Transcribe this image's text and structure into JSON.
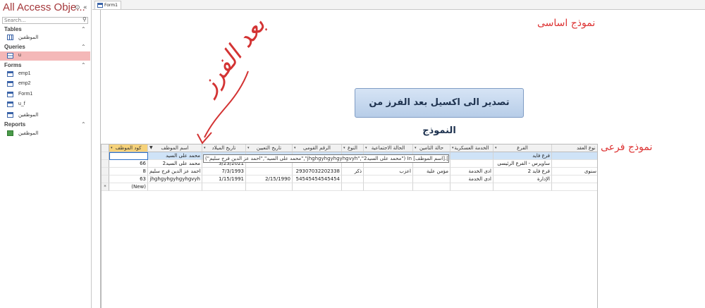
{
  "nav": {
    "title": "All Access Obje...",
    "search_placeholder": "Search...",
    "groups": [
      {
        "label": "Tables",
        "items": [
          {
            "label": "الموظفين",
            "icon": "table-icon"
          }
        ]
      },
      {
        "label": "Queries",
        "items": [
          {
            "label": "u",
            "icon": "query-icon",
            "selected": true
          }
        ]
      },
      {
        "label": "Forms",
        "items": [
          {
            "label": "emp1",
            "icon": "form-icon"
          },
          {
            "label": "emp2",
            "icon": "form-icon"
          },
          {
            "label": "Form1",
            "icon": "form-icon"
          },
          {
            "label": "u_f",
            "icon": "form-icon"
          },
          {
            "label": "الموظفين",
            "icon": "form-icon"
          }
        ]
      },
      {
        "label": "Reports",
        "items": [
          {
            "label": "الموظفين",
            "icon": "report-icon"
          }
        ]
      }
    ]
  },
  "tab": {
    "label": "Form1"
  },
  "form": {
    "main_label": "نموذج اساسى",
    "sub_label": "نموذج فرعى",
    "export_button": "تصدير الى اكسيل بعد الفرز من النموذج",
    "handwriting": "بعد الفرز"
  },
  "grid": {
    "columns": [
      "كود الموظف",
      "اسم الموظف",
      "تاريخ الميلاد",
      "تاريخ التعيين",
      "الرقم القومى",
      "النوع",
      "الحالة الاجتماعية",
      "حالة التامين",
      "الخدمة العسكرية",
      "الفرع",
      "نوع العقد"
    ],
    "rows": [
      [
        "",
        "محمد على السيد",
        "",
        "",
        "",
        "",
        "",
        "",
        "",
        "فرع فايد",
        ""
      ],
      [
        "66",
        "محمد على السيد2",
        "3/23/2021",
        "",
        "",
        "",
        "",
        "",
        "",
        "ساويرس - الفرع الرئيسى",
        ""
      ],
      [
        "8",
        "احمد عز الدين فرج سليم",
        "7/3/1993",
        "",
        "29307032202338",
        "ذكر",
        "اعزب",
        "مؤمن علية",
        "ادى الخدمة",
        "فرع فايد 2",
        "سنوى"
      ],
      [
        "63",
        "jhghgyhgyhgyhgvyh",
        "1/15/1991",
        "2/15/1990",
        "54545454545454",
        "",
        "",
        "",
        "ادى الخدمة",
        "الإدارة",
        ""
      ]
    ],
    "new_row_label": "(New)",
    "new_row_marker": "*",
    "filter_text": "(\"محمد على السيد\",\"احمد عز الدين فرج سليم\",\"jhghgyhgyhgyhgvyh\",\"محمد على السيد2\") In [اسم الموظف].[u]"
  },
  "colors": {
    "accent": "#a4373a",
    "ink": "#d33333",
    "header_first": "#f6d27a",
    "selection": "#cfe3f7"
  }
}
